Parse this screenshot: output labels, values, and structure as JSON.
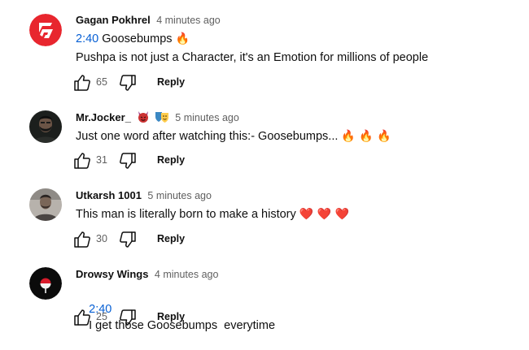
{
  "comments": [
    {
      "author": "Gagan Pokhrel",
      "time": "4 minutes ago",
      "timestamp_link": "2:40",
      "line1": "Goosebumps",
      "line1_emoji": "🔥",
      "line2": "Pushpa is not just a Character, it's an Emotion for millions of people",
      "likes": "65",
      "reply_label": "Reply",
      "avatar_icon": "red-g-logo-icon"
    },
    {
      "author": "Mr.Jocker_",
      "time": "5 minutes ago",
      "line1": "Just one word after watching this:- Goosebumps...",
      "line1_emoji": "🔥 🔥 🔥",
      "likes": "31",
      "reply_label": "Reply",
      "avatar_icon": "bearded-man-photo-icon",
      "name_badges": [
        "devil-emoji-icon",
        "theater-masks-icon"
      ]
    },
    {
      "author": "Utkarsh 1001",
      "time": "5 minutes ago",
      "line1": "This man is literally born to make a history",
      "line1_emoji": "❤️ ❤️ ❤️",
      "likes": "30",
      "reply_label": "Reply",
      "avatar_icon": "man-photo-icon"
    },
    {
      "author": "Drowsy Wings",
      "time": "4 minutes ago",
      "timestamp_link": "2:40",
      "line1": "I get those Goosebumps  everytime",
      "likes": "25",
      "reply_label": "Reply",
      "avatar_icon": "uchiha-crest-icon"
    }
  ],
  "colors": {
    "link_blue": "#065fd4",
    "secondary_text": "#606060",
    "brand_red": "#e8262e",
    "fire_orange": "#f4900c",
    "heart_red": "#dd2e44"
  }
}
